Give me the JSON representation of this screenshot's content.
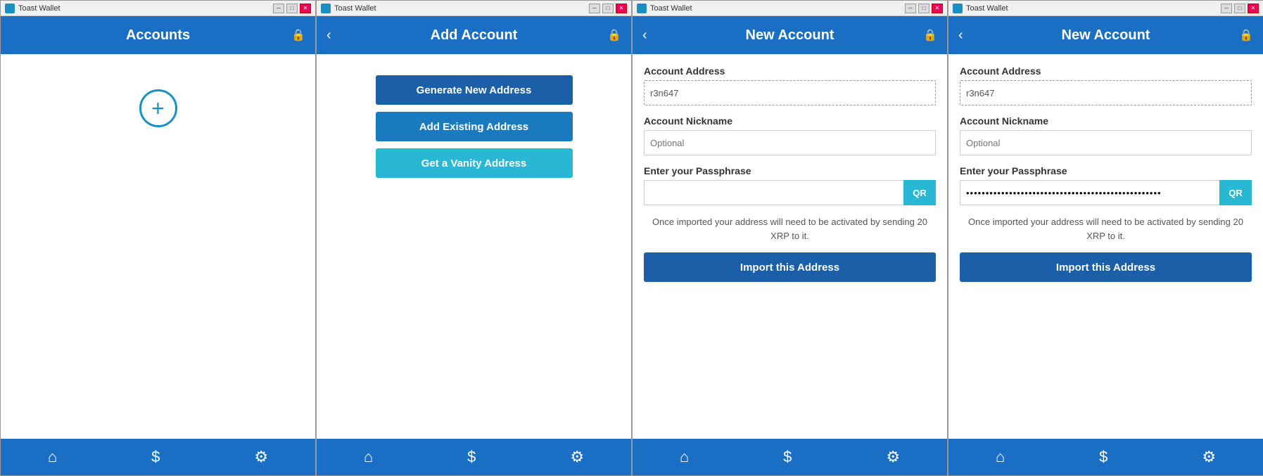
{
  "app": {
    "title": "Toast Wallet"
  },
  "windows": [
    {
      "id": "accounts",
      "title_bar_label": "Toast Wallet",
      "header_title": "Accounts",
      "show_back": false,
      "show_lock": true,
      "type": "accounts"
    },
    {
      "id": "add-account",
      "title_bar_label": "Toast Wallet",
      "header_title": "Add Account",
      "show_back": true,
      "show_lock": true,
      "type": "add-account",
      "buttons": [
        {
          "label": "Generate New Address",
          "style": "dark-blue"
        },
        {
          "label": "Add Existing Address",
          "style": "medium-blue"
        },
        {
          "label": "Get a Vanity Address",
          "style": "cyan"
        }
      ]
    },
    {
      "id": "new-account-1",
      "title_bar_label": "Toast Wallet",
      "header_title": "New Account",
      "show_back": true,
      "show_lock": true,
      "type": "new-account",
      "address_label": "Account Address",
      "address_value": "r3n647",
      "nickname_label": "Account Nickname",
      "nickname_placeholder": "Optional",
      "passphrase_label": "Enter your Passphrase",
      "passphrase_value": "",
      "qr_label": "QR",
      "notice": "Once imported your address will need to be activated by sending 20 XRP to it.",
      "import_btn_label": "Import this Address"
    },
    {
      "id": "new-account-2",
      "title_bar_label": "Toast Wallet",
      "header_title": "New Account",
      "show_back": true,
      "show_lock": true,
      "type": "new-account",
      "address_label": "Account Address",
      "address_value": "r3n647",
      "nickname_label": "Account Nickname",
      "nickname_placeholder": "Optional",
      "passphrase_label": "Enter your Passphrase",
      "passphrase_value": "••••••••••••••••••••••••••••••••••••••••••••••••••••••",
      "qr_label": "QR",
      "notice": "Once imported your address will need to be activated by sending 20 XRP to it.",
      "import_btn_label": "Import this Address"
    }
  ],
  "nav": {
    "home_icon": "⌂",
    "dollar_icon": "$",
    "settings_icon": "⚙"
  },
  "titlebar": {
    "minimize": "─",
    "maximize": "□",
    "close": "✕"
  }
}
